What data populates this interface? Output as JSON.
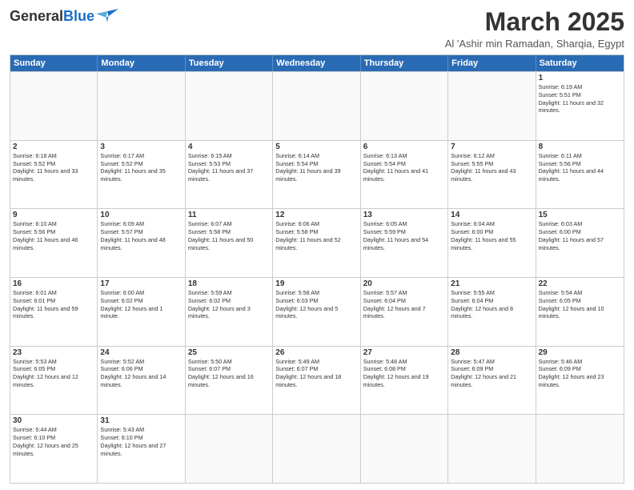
{
  "logo": {
    "text_general": "General",
    "text_blue": "Blue",
    "tagline": ""
  },
  "header": {
    "title": "March 2025",
    "subtitle": "Al 'Ashir min Ramadan, Sharqia, Egypt"
  },
  "weekdays": [
    "Sunday",
    "Monday",
    "Tuesday",
    "Wednesday",
    "Thursday",
    "Friday",
    "Saturday"
  ],
  "weeks": [
    [
      {
        "day": "",
        "info": ""
      },
      {
        "day": "",
        "info": ""
      },
      {
        "day": "",
        "info": ""
      },
      {
        "day": "",
        "info": ""
      },
      {
        "day": "",
        "info": ""
      },
      {
        "day": "",
        "info": ""
      },
      {
        "day": "1",
        "info": "Sunrise: 6:19 AM\nSunset: 5:51 PM\nDaylight: 11 hours and 32 minutes."
      }
    ],
    [
      {
        "day": "2",
        "info": "Sunrise: 6:18 AM\nSunset: 5:52 PM\nDaylight: 11 hours and 33 minutes."
      },
      {
        "day": "3",
        "info": "Sunrise: 6:17 AM\nSunset: 5:52 PM\nDaylight: 11 hours and 35 minutes."
      },
      {
        "day": "4",
        "info": "Sunrise: 6:15 AM\nSunset: 5:53 PM\nDaylight: 11 hours and 37 minutes."
      },
      {
        "day": "5",
        "info": "Sunrise: 6:14 AM\nSunset: 5:54 PM\nDaylight: 11 hours and 39 minutes."
      },
      {
        "day": "6",
        "info": "Sunrise: 6:13 AM\nSunset: 5:54 PM\nDaylight: 11 hours and 41 minutes."
      },
      {
        "day": "7",
        "info": "Sunrise: 6:12 AM\nSunset: 5:55 PM\nDaylight: 11 hours and 43 minutes."
      },
      {
        "day": "8",
        "info": "Sunrise: 6:11 AM\nSunset: 5:56 PM\nDaylight: 11 hours and 44 minutes."
      }
    ],
    [
      {
        "day": "9",
        "info": "Sunrise: 6:10 AM\nSunset: 5:56 PM\nDaylight: 11 hours and 46 minutes."
      },
      {
        "day": "10",
        "info": "Sunrise: 6:09 AM\nSunset: 5:57 PM\nDaylight: 11 hours and 48 minutes."
      },
      {
        "day": "11",
        "info": "Sunrise: 6:07 AM\nSunset: 5:58 PM\nDaylight: 11 hours and 50 minutes."
      },
      {
        "day": "12",
        "info": "Sunrise: 6:06 AM\nSunset: 5:58 PM\nDaylight: 11 hours and 52 minutes."
      },
      {
        "day": "13",
        "info": "Sunrise: 6:05 AM\nSunset: 5:59 PM\nDaylight: 11 hours and 54 minutes."
      },
      {
        "day": "14",
        "info": "Sunrise: 6:04 AM\nSunset: 6:00 PM\nDaylight: 11 hours and 55 minutes."
      },
      {
        "day": "15",
        "info": "Sunrise: 6:03 AM\nSunset: 6:00 PM\nDaylight: 11 hours and 57 minutes."
      }
    ],
    [
      {
        "day": "16",
        "info": "Sunrise: 6:01 AM\nSunset: 6:01 PM\nDaylight: 11 hours and 59 minutes."
      },
      {
        "day": "17",
        "info": "Sunrise: 6:00 AM\nSunset: 6:02 PM\nDaylight: 12 hours and 1 minute."
      },
      {
        "day": "18",
        "info": "Sunrise: 5:59 AM\nSunset: 6:02 PM\nDaylight: 12 hours and 3 minutes."
      },
      {
        "day": "19",
        "info": "Sunrise: 5:58 AM\nSunset: 6:03 PM\nDaylight: 12 hours and 5 minutes."
      },
      {
        "day": "20",
        "info": "Sunrise: 5:57 AM\nSunset: 6:04 PM\nDaylight: 12 hours and 7 minutes."
      },
      {
        "day": "21",
        "info": "Sunrise: 5:55 AM\nSunset: 6:04 PM\nDaylight: 12 hours and 8 minutes."
      },
      {
        "day": "22",
        "info": "Sunrise: 5:54 AM\nSunset: 6:05 PM\nDaylight: 12 hours and 10 minutes."
      }
    ],
    [
      {
        "day": "23",
        "info": "Sunrise: 5:53 AM\nSunset: 6:05 PM\nDaylight: 12 hours and 12 minutes."
      },
      {
        "day": "24",
        "info": "Sunrise: 5:52 AM\nSunset: 6:06 PM\nDaylight: 12 hours and 14 minutes."
      },
      {
        "day": "25",
        "info": "Sunrise: 5:50 AM\nSunset: 6:07 PM\nDaylight: 12 hours and 16 minutes."
      },
      {
        "day": "26",
        "info": "Sunrise: 5:49 AM\nSunset: 6:07 PM\nDaylight: 12 hours and 18 minutes."
      },
      {
        "day": "27",
        "info": "Sunrise: 5:48 AM\nSunset: 6:08 PM\nDaylight: 12 hours and 19 minutes."
      },
      {
        "day": "28",
        "info": "Sunrise: 5:47 AM\nSunset: 6:09 PM\nDaylight: 12 hours and 21 minutes."
      },
      {
        "day": "29",
        "info": "Sunrise: 5:46 AM\nSunset: 6:09 PM\nDaylight: 12 hours and 23 minutes."
      }
    ],
    [
      {
        "day": "30",
        "info": "Sunrise: 5:44 AM\nSunset: 6:10 PM\nDaylight: 12 hours and 25 minutes."
      },
      {
        "day": "31",
        "info": "Sunrise: 5:43 AM\nSunset: 6:10 PM\nDaylight: 12 hours and 27 minutes."
      },
      {
        "day": "",
        "info": ""
      },
      {
        "day": "",
        "info": ""
      },
      {
        "day": "",
        "info": ""
      },
      {
        "day": "",
        "info": ""
      },
      {
        "day": "",
        "info": ""
      }
    ]
  ]
}
